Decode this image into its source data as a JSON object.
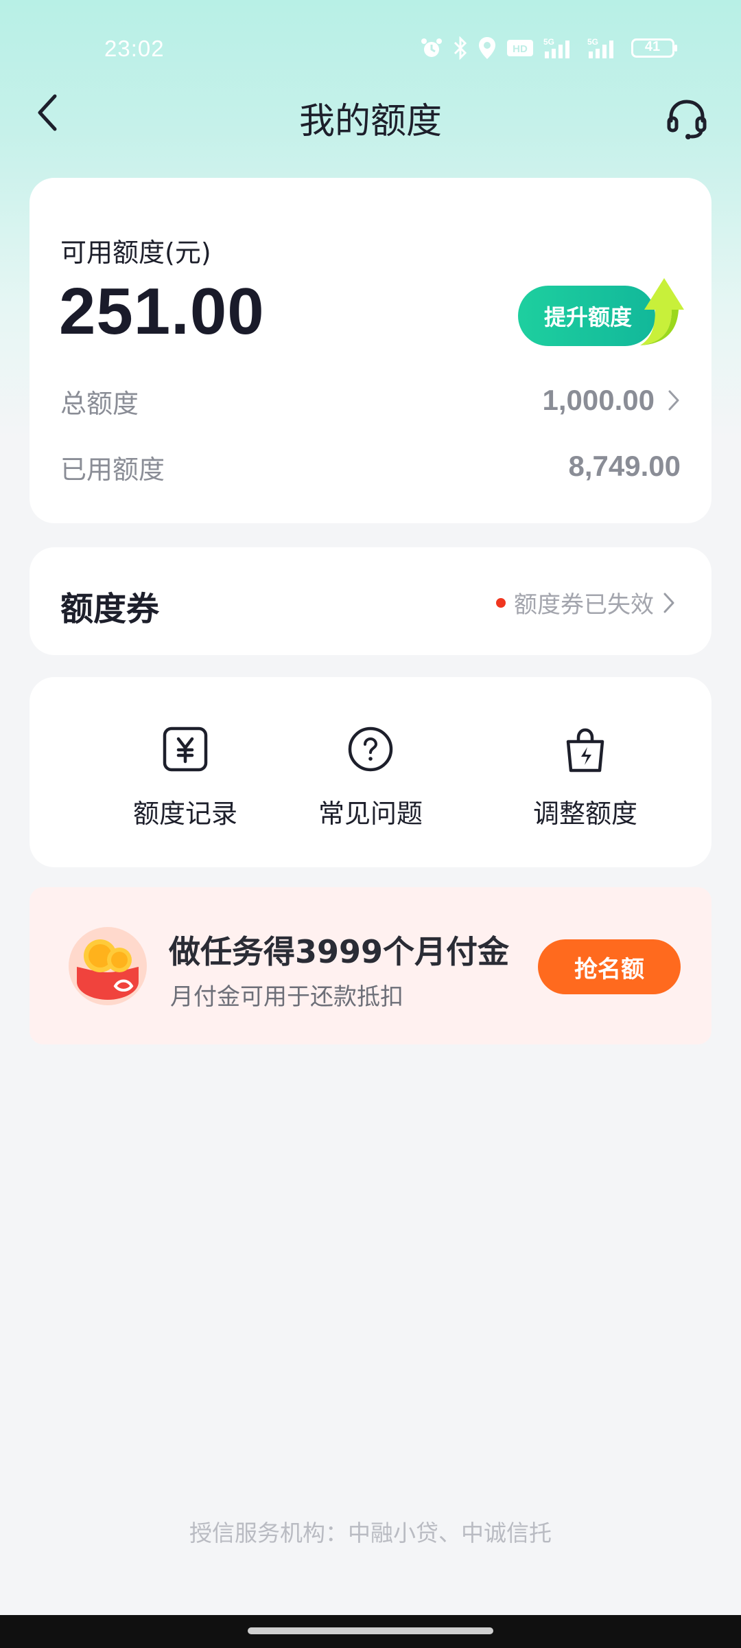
{
  "status_bar": {
    "time": "23:02",
    "battery": "41",
    "icons": [
      "alarm-icon",
      "bluetooth-icon",
      "location-icon",
      "hd-icon",
      "signal-5g-icon",
      "signal-5g-icon-2",
      "battery-icon"
    ]
  },
  "nav": {
    "title": "我的额度",
    "back_icon": "chevron-left-icon",
    "service_icon": "headset-icon"
  },
  "quota": {
    "label": "可用额度(元)",
    "available": "251.00",
    "raise_button": "提升额度",
    "total_label": "总额度",
    "total_value": "1,000.00",
    "used_label": "已用额度",
    "used_value": "8,749.00"
  },
  "coupon": {
    "title": "额度券",
    "status": "额度券已失效"
  },
  "actions": [
    {
      "label": "额度记录",
      "icon": "yuan-icon"
    },
    {
      "label": "常见问题",
      "icon": "question-icon"
    },
    {
      "label": "调整额度",
      "icon": "bag-lightning-icon"
    }
  ],
  "promo": {
    "title": "做任务得3999个月付金",
    "subtitle": "月付金可用于还款抵扣",
    "button": "抢名额"
  },
  "footer": {
    "text": "授信服务机构：中融小贷、中诚信托"
  },
  "colors": {
    "accent_green": "#12b89a",
    "accent_orange": "#ff6a1e",
    "red_dot": "#f0361f"
  }
}
